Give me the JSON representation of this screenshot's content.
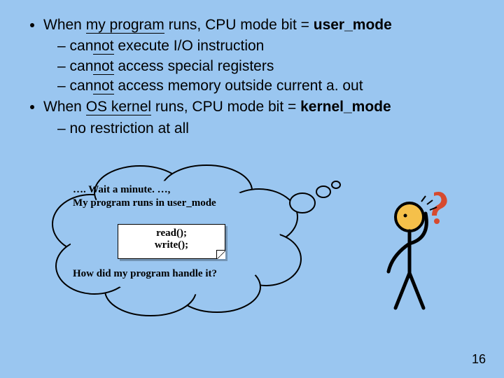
{
  "bullets": {
    "b1_pre": "When ",
    "b1_ul": "my program",
    "b1_post": " runs,  CPU mode bit =  ",
    "b1_bold": "user_mode",
    "b1_subs": {
      "s1_pre": "can",
      "s1_ul": "not",
      "s1_post": " execute I/O instruction",
      "s2_pre": "can",
      "s2_ul": "not",
      "s2_post": " access special registers",
      "s3_pre": "can",
      "s3_ul": "not",
      "s3_post": " access memory outside current a. out"
    },
    "b2_pre": "When ",
    "b2_ul": "OS kernel",
    "b2_post": " runs, CPU mode bit =  ",
    "b2_bold": "kernel_mode",
    "b2_subs": {
      "s1": "no restriction at all"
    }
  },
  "thought": {
    "line1": "…. Wait a minute. …,",
    "line2": "My program runs  in user_mode",
    "code1": "read();",
    "code2": "write();",
    "question": "How did my program handle it?"
  },
  "page_number": "16",
  "icons": {
    "thought_bubble": "thought-bubble-icon",
    "person": "thinking-person-icon"
  }
}
